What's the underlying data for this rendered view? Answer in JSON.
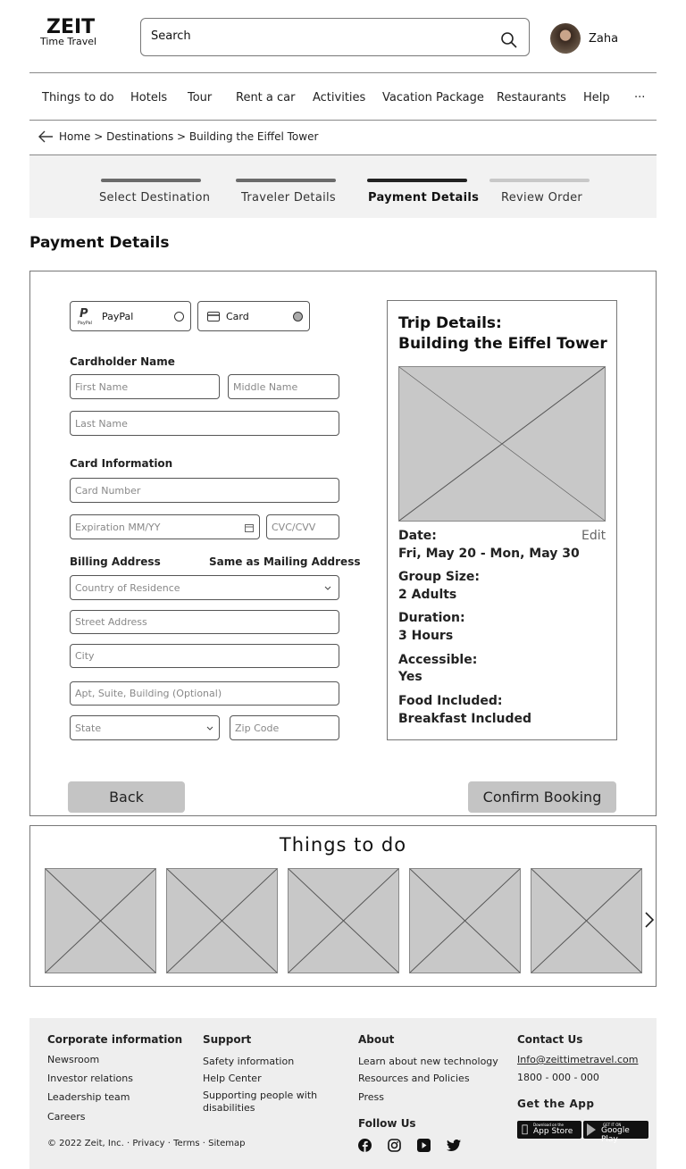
{
  "header": {
    "logo": "ZEIT",
    "logo_sub": "Time Travel",
    "search_placeholder": "Search",
    "user_name": "Zaha"
  },
  "nav": [
    "Things to do",
    "Hotels",
    "Tour",
    "Rent a car",
    "Activities",
    "Vacation Package",
    "Restaurants",
    "Help"
  ],
  "nav_more": "···",
  "breadcrumb": "Home > Destinations > Building the Eiffel Tower",
  "steps": [
    {
      "label": "Select Destination",
      "state": "done"
    },
    {
      "label": "Traveler Details",
      "state": "done"
    },
    {
      "label": "Payment Details",
      "state": "active"
    },
    {
      "label": "Review Order",
      "state": "todo"
    }
  ],
  "page_title": "Payment Details",
  "payment": {
    "paypal_label": "PayPal",
    "paypal_logo": "PayPal",
    "card_label": "Card",
    "selected": "Card",
    "cardholder_label": "Cardholder  Name",
    "first_name": "First Name",
    "middle_name": "Middle Name",
    "last_name": "Last Name",
    "card_info_label": "Card Information",
    "card_number": "Card Number",
    "expiration": "Expiration  MM/YY",
    "cvc": "CVC/CVV",
    "billing_label": "Billing Address",
    "same_as_mailing": "Same as Mailing Address",
    "country": "Country of Residence",
    "street": "Street Address",
    "city": "City",
    "apt": "Apt, Suite, Building (Optional)",
    "state": "State",
    "zip": "Zip Code"
  },
  "trip": {
    "title1": "Trip Details:",
    "title2": "Building the Eiffel Tower",
    "edit": "Edit",
    "items": [
      {
        "k": "Date:",
        "v": "Fri, May 20 - Mon, May 30"
      },
      {
        "k": "Group Size:",
        "v": "2 Adults"
      },
      {
        "k": "Duration:",
        "v": "3 Hours"
      },
      {
        "k": "Accessible:",
        "v": "Yes"
      },
      {
        "k": "Food Included:",
        "v": "Breakfast Included"
      }
    ]
  },
  "actions": {
    "back": "Back",
    "confirm": "Confirm Booking"
  },
  "things": {
    "title": "Things to do"
  },
  "footer": {
    "corp": {
      "title": "Corporate information",
      "links": [
        "Newsroom",
        "Investor relations",
        "Leadership team",
        "Careers"
      ]
    },
    "support": {
      "title": "Support",
      "links": [
        "Safety information",
        "Help Center",
        "Supporting people  with disabilities"
      ]
    },
    "about": {
      "title": "About",
      "links": [
        "Learn about new technology",
        "Resources and Policies",
        "Press"
      ]
    },
    "follow": "Follow Us",
    "contact": {
      "title": "Contact Us",
      "email": "Info@zeittimetravel.com",
      "phone": "1800 - 000 - 000"
    },
    "get_app": "Get the App",
    "app_store_small": "Download on the",
    "app_store": "App Store",
    "google_small": "GET IT ON",
    "google": "Google Play",
    "copyright": "© 2022 Zeit, Inc. · Privacy · Terms · Sitemap"
  },
  "colors": {
    "step_done": "#6b6b6b",
    "step_active": "#222222",
    "step_todo": "#c8c8c8",
    "button": "#c4c4c4",
    "stepper_bg": "#f2f2f2",
    "footer_bg": "#eeeeee"
  }
}
